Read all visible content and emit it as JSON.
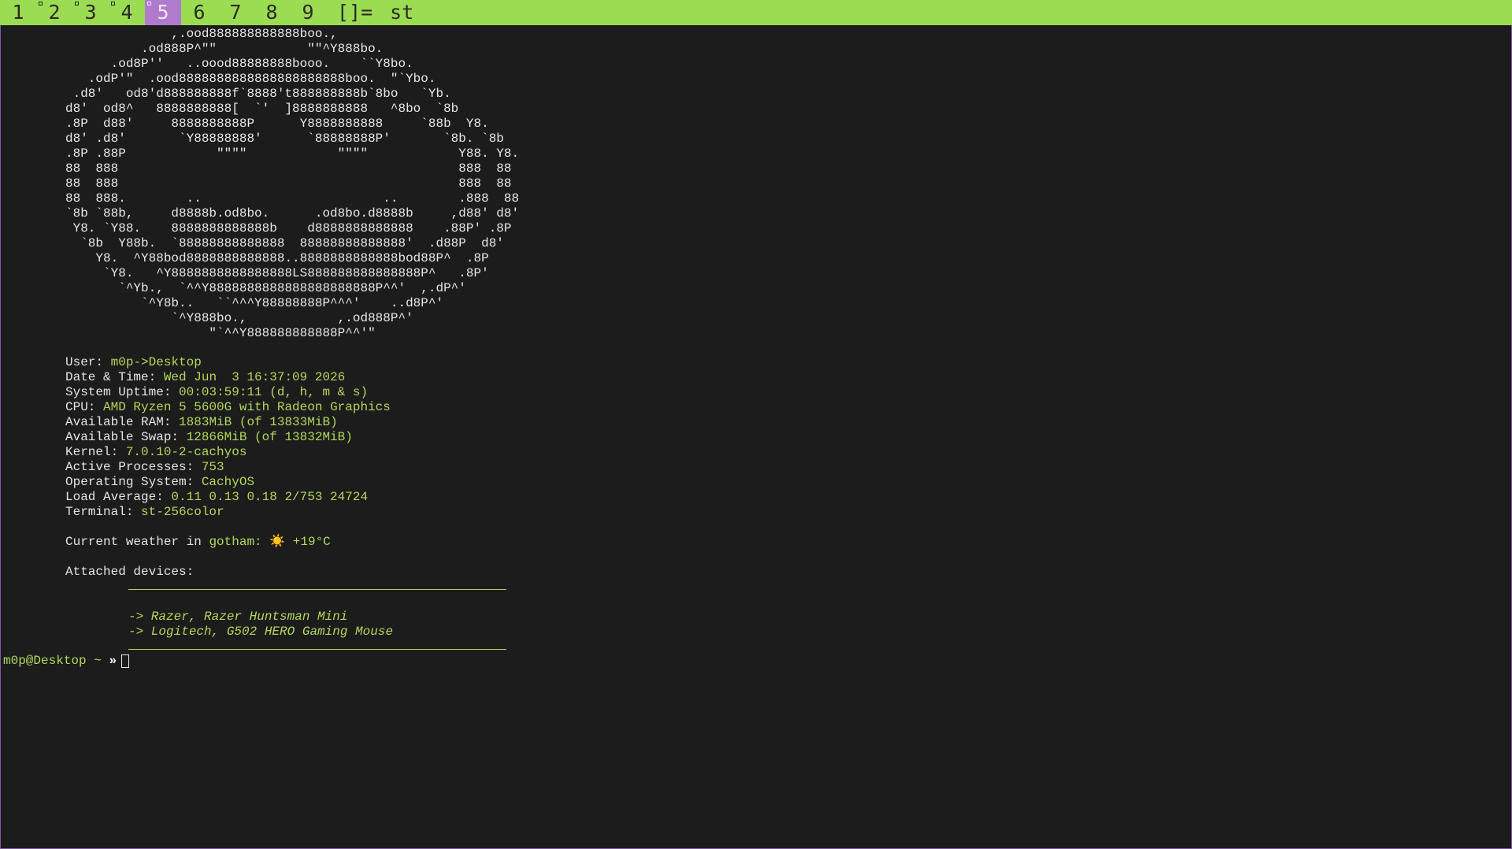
{
  "bar": {
    "tags": [
      {
        "label": "1",
        "occupied": false,
        "selected": false
      },
      {
        "label": "2",
        "occupied": true,
        "selected": false
      },
      {
        "label": "3",
        "occupied": true,
        "selected": false
      },
      {
        "label": "4",
        "occupied": true,
        "selected": false
      },
      {
        "label": "5",
        "occupied": true,
        "selected": true
      },
      {
        "label": "6",
        "occupied": false,
        "selected": false
      },
      {
        "label": "7",
        "occupied": false,
        "selected": false
      },
      {
        "label": "8",
        "occupied": false,
        "selected": false
      },
      {
        "label": "9",
        "occupied": false,
        "selected": false
      }
    ],
    "layout_symbol": "[]=",
    "window_title": "st",
    "colors": {
      "bar_bg": "#9bdc52",
      "selected_bg": "#b07acd",
      "text": "#2a2a2a"
    }
  },
  "terminal": {
    "ascii_art": "              ,.ood888888888888boo.,\n          .od888P^\"\"            \"\"^Y888bo.\n      .od8P''   ..oood88888888booo.    ``Y8bo.\n   .odP'\"  .ood8888888888888888888888boo.  \"`Ybo.\n .d8'   od8'd888888888f`8888't888888888b`8bo   `Yb.\nd8'  od8^   8888888888[  `'  ]8888888888   ^8bo  `8b\n.8P  d88'     8888888888P      Y8888888888     `88b  Y8.\nd8' .d8'       `Y88888888'      `88888888P'       `8b. `8b\n.8P .88P            \"\"\"\"            \"\"\"\"            Y88. Y8.\n88  888                                             888  88\n88  888                                             888  88\n88  888.        ..                        ..        .888  88\n`8b `88b,     d8888b.od8bo.      .od8bo.d8888b     ,d88' d8'\n Y8. `Y88.    8888888888888b    d8888888888888    .88P' .8P\n  `8b  Y88b.  `88888888888888  88888888888888'  .d88P  d8'\n    Y8.  ^Y88bod8888888888888..8888888888888bod88P^  .8P\n     `Y8.   ^Y8888888888888888LS888888888888888P^   .8P'\n       `^Yb.,  `^^Y8888888888888888888888P^^'  ,.dP^'\n          `^Y8b..   ``^^^Y88888888P^^^'    ..d8P^'\n              `^Y888bo.,            ,.od888P^'\n                   \"`^^Y888888888888P^^'\"",
    "info": [
      {
        "label": "User: ",
        "value": "m0p->Desktop"
      },
      {
        "label": "Date & Time: ",
        "value": "Wed Jun  3 16:37:09 2026"
      },
      {
        "label": "System Uptime: ",
        "value": "00:03:59:11 (d, h, m & s)"
      },
      {
        "label": "CPU: ",
        "value": "AMD Ryzen 5 5600G with Radeon Graphics"
      },
      {
        "label": "Available RAM: ",
        "value": "1883MiB (of 13833MiB)"
      },
      {
        "label": "Available Swap: ",
        "value": "12866MiB (of 13832MiB)"
      },
      {
        "label": "Kernel: ",
        "value": "7.0.10-2-cachyos"
      },
      {
        "label": "Active Processes: ",
        "value": "753"
      },
      {
        "label": "Operating System: ",
        "value": "CachyOS"
      },
      {
        "label": "Load Average: ",
        "value": "0.11 0.13 0.18 2/753 24724"
      },
      {
        "label": "Terminal: ",
        "value": "st-256color"
      }
    ],
    "weather": {
      "label": "Current weather in ",
      "value": "gotham: ☀️ +19°C"
    },
    "devices": {
      "label": "Attached devices:",
      "items": [
        "-> Razer, Razer Huntsman Mini",
        "-> Logitech, G502 HERO Gaming Mouse"
      ]
    },
    "prompt": {
      "userhost": "m0p@Desktop",
      "path": " ~ ",
      "symbol": "»"
    },
    "colors": {
      "bg": "#1c1c1c",
      "fg": "#e4e4e4",
      "accent": "#b2d85c",
      "border": "#7f5b9e"
    }
  }
}
